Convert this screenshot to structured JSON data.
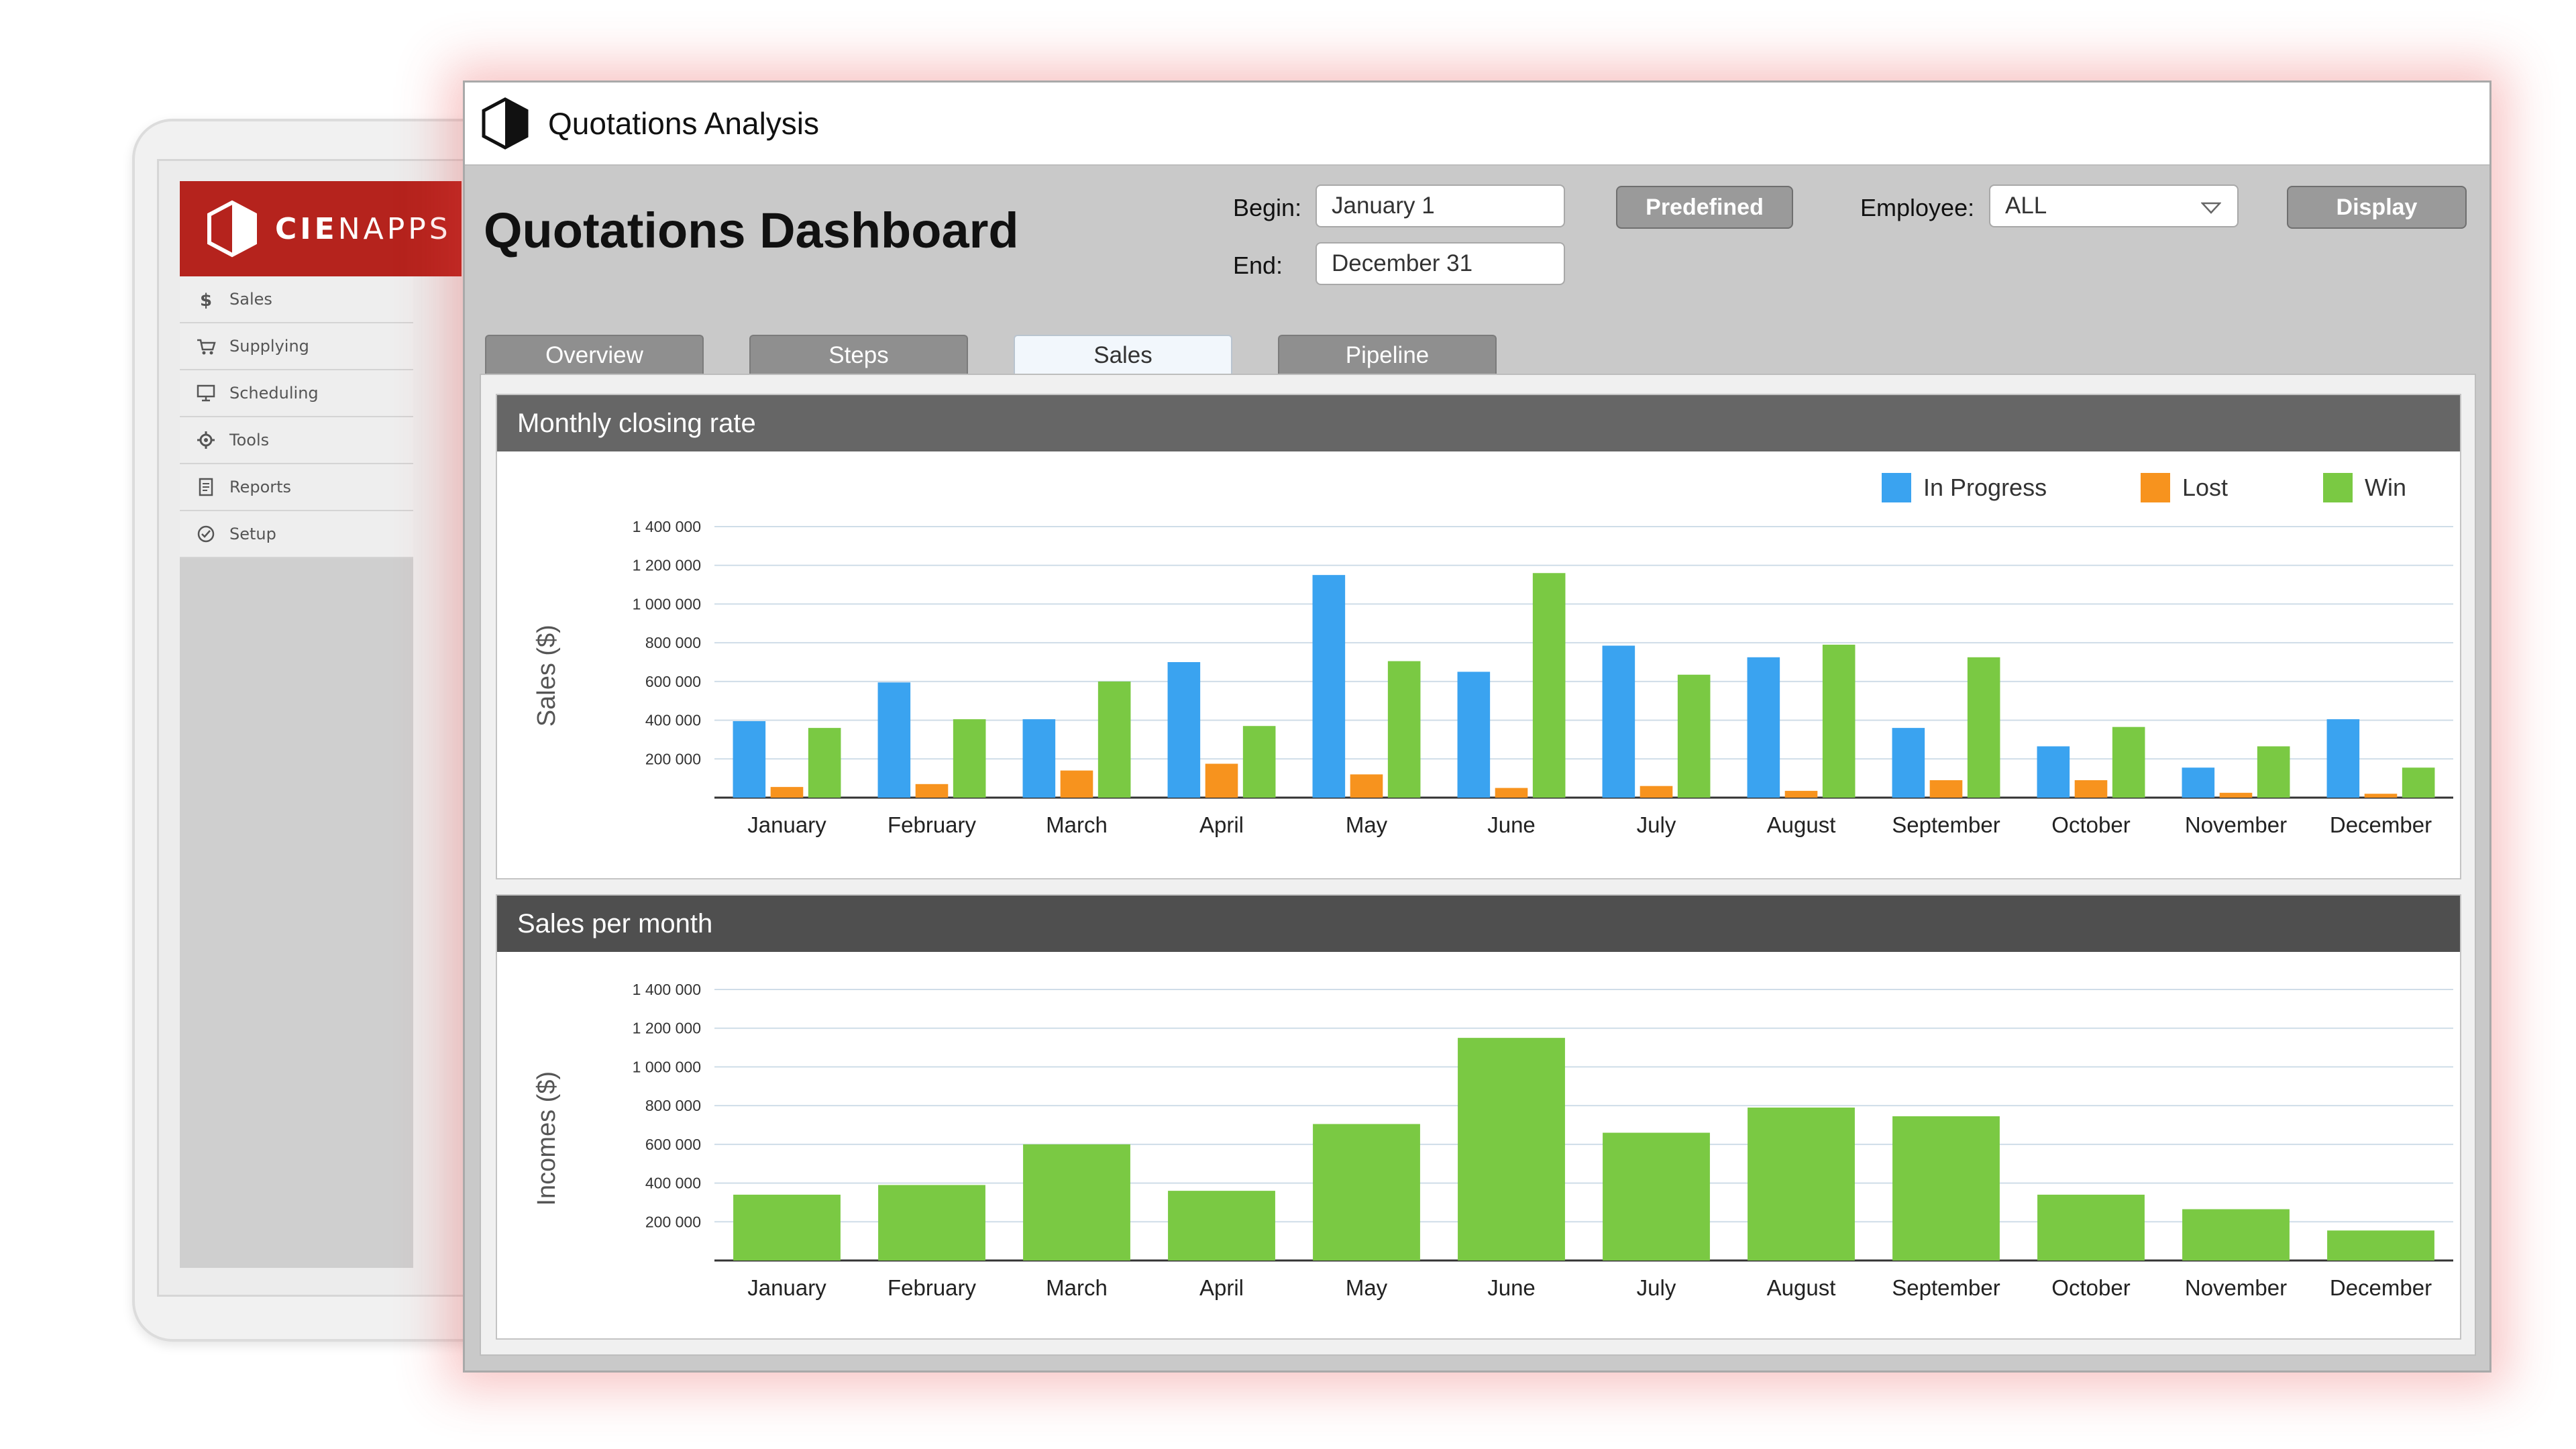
{
  "tablet": {
    "brand": {
      "bold": "CIE",
      "rest": "NAPPS"
    },
    "sidebar": {
      "items": [
        {
          "label": "Sales",
          "icon": "dollar-icon"
        },
        {
          "label": "Supplying",
          "icon": "cart-icon"
        },
        {
          "label": "Scheduling",
          "icon": "monitor-icon"
        },
        {
          "label": "Tools",
          "icon": "gear-icon"
        },
        {
          "label": "Reports",
          "icon": "document-icon"
        },
        {
          "label": "Setup",
          "icon": "check-circle-icon"
        }
      ]
    }
  },
  "window": {
    "title": "Quotations Analysis",
    "dashboard_title": "Quotations Dashboard"
  },
  "filters": {
    "begin_label": "Begin:",
    "begin_value": "January 1",
    "end_label": "End:",
    "end_value": "December 31",
    "predefined_label": "Predefined",
    "employee_label": "Employee:",
    "employee_value": "ALL",
    "display_label": "Display"
  },
  "tabs": [
    {
      "label": "Overview",
      "active": false
    },
    {
      "label": "Steps",
      "active": false
    },
    {
      "label": "Sales",
      "active": true
    },
    {
      "label": "Pipeline",
      "active": false
    }
  ],
  "colors": {
    "brand_red": "#b5231d",
    "in_progress": "#3aa3f0",
    "lost": "#f7931e",
    "win": "#7ac943",
    "panel_head_1": "#666666",
    "panel_head_2": "#4f4f4f"
  },
  "chart_data": [
    {
      "type": "bar",
      "title": "Monthly closing rate",
      "xlabel": "",
      "ylabel": "Sales ($)",
      "ylim": [
        0,
        1400000
      ],
      "yticks": [
        200000,
        400000,
        600000,
        800000,
        1000000,
        1200000,
        1400000
      ],
      "ytick_labels": [
        "200 000",
        "400 000",
        "600 000",
        "800 000",
        "1 000 000",
        "1 200 000",
        "1 400 000"
      ],
      "grid": true,
      "legend": "top-right",
      "categories": [
        "January",
        "February",
        "March",
        "April",
        "May",
        "June",
        "July",
        "August",
        "September",
        "October",
        "November",
        "December"
      ],
      "series": [
        {
          "name": "In Progress",
          "color": "#3aa3f0",
          "values": [
            395000,
            595000,
            405000,
            700000,
            1150000,
            650000,
            785000,
            725000,
            360000,
            265000,
            155000,
            405000
          ]
        },
        {
          "name": "Lost",
          "color": "#f7931e",
          "values": [
            55000,
            70000,
            140000,
            175000,
            120000,
            50000,
            60000,
            35000,
            90000,
            90000,
            25000,
            20000
          ]
        },
        {
          "name": "Win",
          "color": "#7ac943",
          "values": [
            360000,
            405000,
            600000,
            370000,
            705000,
            1160000,
            635000,
            790000,
            725000,
            365000,
            265000,
            155000
          ]
        }
      ]
    },
    {
      "type": "bar",
      "title": "Sales per month",
      "xlabel": "",
      "ylabel": "Incomes ($)",
      "ylim": [
        0,
        1400000
      ],
      "yticks": [
        200000,
        400000,
        600000,
        800000,
        1000000,
        1200000,
        1400000
      ],
      "ytick_labels": [
        "200 000",
        "400 000",
        "600 000",
        "800 000",
        "1 000 000",
        "1 200 000",
        "1 400 000"
      ],
      "grid": true,
      "categories": [
        "January",
        "February",
        "March",
        "April",
        "May",
        "June",
        "July",
        "August",
        "September",
        "October",
        "November",
        "December"
      ],
      "series": [
        {
          "color": "#7ac943",
          "values": [
            340000,
            390000,
            600000,
            360000,
            705000,
            1150000,
            660000,
            790000,
            745000,
            340000,
            265000,
            155000
          ]
        }
      ]
    }
  ]
}
